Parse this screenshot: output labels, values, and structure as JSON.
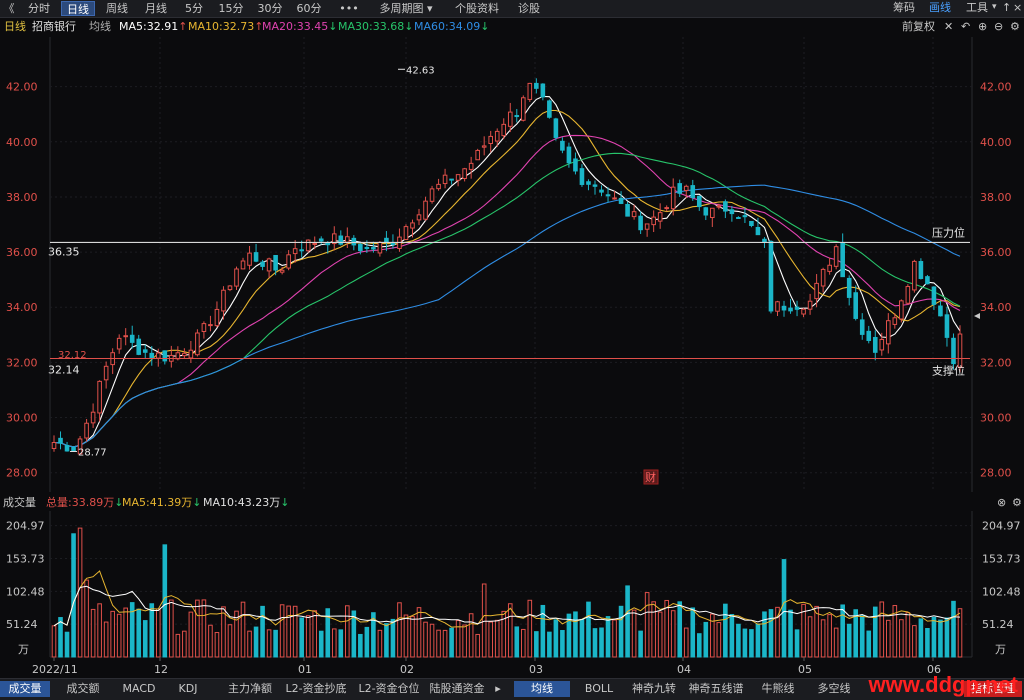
{
  "topbar": {
    "back_glyph": "《",
    "tabs": [
      {
        "label": "分时",
        "active": false
      },
      {
        "label": "日线",
        "active": true
      },
      {
        "label": "周线",
        "active": false
      },
      {
        "label": "月线",
        "active": false
      },
      {
        "label": "5分",
        "active": false
      },
      {
        "label": "15分",
        "active": false
      },
      {
        "label": "30分",
        "active": false
      },
      {
        "label": "60分",
        "active": false
      },
      {
        "label": "•••",
        "active": false
      },
      {
        "label": "多周期图 ▾",
        "active": false
      },
      {
        "label": "个股资料",
        "active": false
      },
      {
        "label": "诊股",
        "active": false
      }
    ],
    "right": {
      "chips": "筹码",
      "draw": "画线",
      "tools": "工具",
      "tools_arrow": "▾",
      "up_arrow": "↑",
      "close": "×"
    }
  },
  "legend": {
    "period": "日线",
    "stock": "招商银行",
    "ma_label": "均线",
    "ma5": "MA5:32.91",
    "ma5_arrow": "↑",
    "ma10": "MA10:32.73",
    "ma10_arrow": "↑",
    "ma20": "MA20:33.45",
    "ma20_arrow": "↓",
    "ma30": "MA30:33.68",
    "ma30_arrow": "↓",
    "ma60": "MA60:34.09",
    "ma60_arrow": "↓",
    "adjust": "前复权",
    "adjust_arrow": "✕"
  },
  "colors": {
    "up": "#e0504a",
    "down": "#1bb6c8",
    "ma5": "#ffffff",
    "ma10": "#e8b630",
    "ma20": "#e043b0",
    "ma30": "#27c46a",
    "ma60": "#2f8de4"
  },
  "price_axis": {
    "ticks": [
      "42.00",
      "40.00",
      "38.00",
      "36.00",
      "34.00",
      "32.00",
      "30.00",
      "28.00"
    ],
    "ylim": [
      27.3,
      43.8
    ]
  },
  "annotations": {
    "high": "42.63",
    "low": "28.77",
    "resistance_value": "36.35",
    "resistance_label": "压力位",
    "support_value": "32.14",
    "support_label": "支撑位",
    "start_price": "32.12",
    "fin_badge": "财"
  },
  "volume": {
    "title": "成交量",
    "total": "总量:33.89万",
    "total_arrow": "↓",
    "ma5": "MA5:41.39万",
    "ma5_arrow": "↓",
    "ma10": "MA10:43.23万",
    "ma10_arrow": "↓",
    "ticks": [
      "204.97",
      "153.73",
      "102.48",
      "51.24"
    ],
    "unit": "万"
  },
  "x_axis": {
    "labels": [
      "2022/11",
      "12",
      "01",
      "02",
      "03",
      "04",
      "05",
      "06"
    ]
  },
  "bottombar": {
    "tabs": [
      {
        "label": "成交量",
        "active": true
      },
      {
        "label": "成交额",
        "active": false
      },
      {
        "label": "MACD",
        "active": false
      },
      {
        "label": "KDJ",
        "active": false
      },
      {
        "label": "主力净额",
        "active": false
      },
      {
        "label": "L2-资金抄底",
        "active": false
      },
      {
        "label": "L2-资金仓位",
        "active": false
      },
      {
        "label": "陆股通资金",
        "active": false
      },
      {
        "label": "▸",
        "active": false
      },
      {
        "label": "均线",
        "active": true
      },
      {
        "label": "BOLL",
        "active": false
      },
      {
        "label": "神奇九转",
        "active": false
      },
      {
        "label": "神奇五线谱",
        "active": false
      },
      {
        "label": "牛熊线",
        "active": false
      },
      {
        "label": "多空线",
        "active": false
      }
    ],
    "right_btn": "指标管理",
    "watermark": "www.ddgp.net"
  },
  "chart_data": {
    "type": "candlestick",
    "title": "",
    "ylim": [
      27.3,
      43.8
    ],
    "support": 32.14,
    "resistance": 36.35,
    "high_marker": 42.63,
    "low_marker": 28.77
  }
}
